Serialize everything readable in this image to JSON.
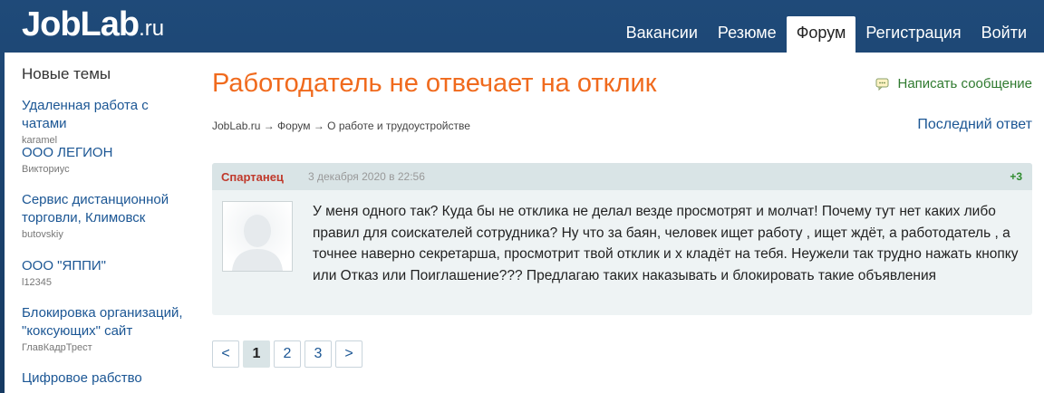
{
  "header": {
    "logo_main": "JobLab",
    "logo_tld": ".ru",
    "nav": [
      {
        "label": "Вакансии"
      },
      {
        "label": "Резюме"
      },
      {
        "label": "Форум",
        "active": true
      },
      {
        "label": "Регистрация"
      },
      {
        "label": "Войти"
      }
    ]
  },
  "sidebar": {
    "title": "Новые темы",
    "topics": [
      {
        "title": "Удаленная работа с чатами",
        "author": "karamel"
      },
      {
        "title": "ООО ЛЕГИОН",
        "author": "Викториус"
      },
      {
        "title": "Сервис дистанционной торговли, Климовск",
        "author": "butovskiy"
      },
      {
        "title": "ООО \"ЯППИ\"",
        "author": "l12345"
      },
      {
        "title": "Блокировка организаций, \"коксующих\" сайт",
        "author": "ГлавКадрТрест"
      },
      {
        "title": "Цифровое рабство",
        "author": ""
      }
    ]
  },
  "main": {
    "title": "Работодатель не отвечает на отклик",
    "write_message": "Написать сообщение",
    "breadcrumb": "JobLab.ru → Форум → О работе и трудоустройстве",
    "last_answer": "Последний ответ",
    "post": {
      "author": "Спартанец",
      "date": "3 декабря 2020 в 22:56",
      "rating": "+3",
      "text": "У меня одного так? Куда бы не отклика не делал везде просмотрят и молчат! Почему тут нет каких либо правил для соискателей сотрудника? Ну что за баян, человек ищет работу , ищет ждёт, а работодатель , а точнее наверно секретарша, просмотрит твой отклик и х кладёт на тебя. Неужели так трудно нажать кнопку или Отказ или Поиглашение??? Предлагаю таких наказывать и блокировать такие объявления"
    },
    "pagination": {
      "prev": "<",
      "pages": [
        "1",
        "2",
        "3"
      ],
      "current": "1",
      "next": ">"
    }
  },
  "colors": {
    "header_bg": "#1f4a79",
    "title_orange": "#f06a1d",
    "link_blue": "#1b5694",
    "author_red": "#c0392b",
    "rating_green": "#2e8b2e"
  }
}
